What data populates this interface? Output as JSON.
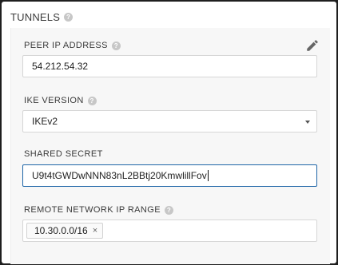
{
  "section": {
    "title": "TUNNELS"
  },
  "peer_ip": {
    "label": "PEER IP ADDRESS",
    "value": "54.212.54.32"
  },
  "ike": {
    "label": "IKE VERSION",
    "value": "IKEv2"
  },
  "secret": {
    "label": "SHARED SECRET",
    "value": "U9t4tGWDwNNN83nL2BBtj20KmwlillFov"
  },
  "remote": {
    "label": "REMOTE NETWORK IP RANGE",
    "tags": [
      "10.30.0.0/16"
    ],
    "remove_glyph": "×"
  },
  "icons": {
    "help": "help-circle-icon",
    "edit": "pencil-icon",
    "dropdown": "chevron-down-icon",
    "remove": "close-icon"
  }
}
